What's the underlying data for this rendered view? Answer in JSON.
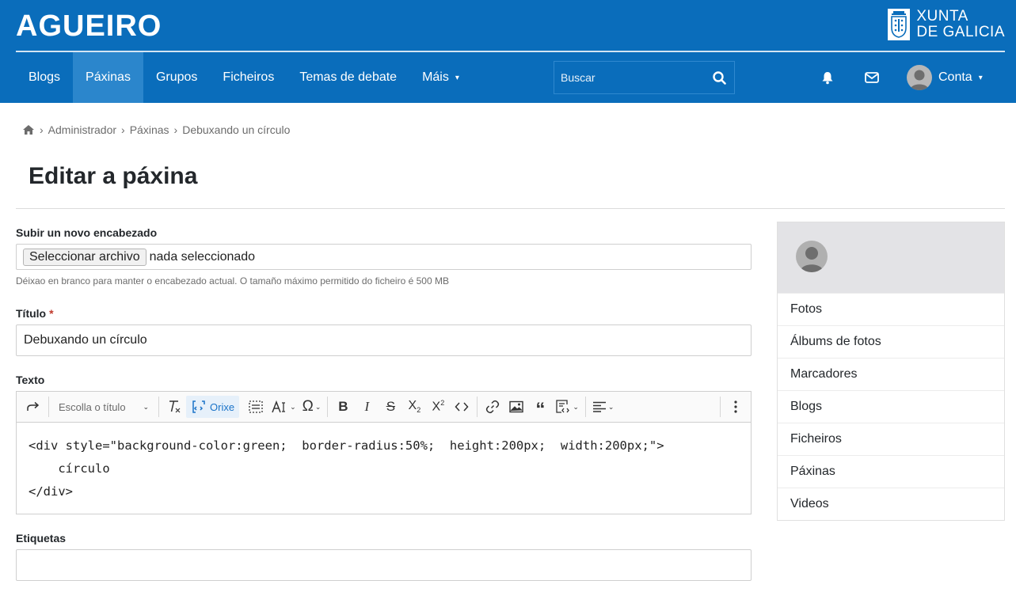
{
  "brand": {
    "name": "AGUEIRO",
    "logo_line1": "XUNTA",
    "logo_line2": "DE GALICIA",
    "seal_icon": "xunta-seal-icon"
  },
  "colors": {
    "header_bg": "#0a6dbb",
    "nav_active_bg": "#2b86cc",
    "accent": "#1a73c8",
    "sidebar_head_bg": "#e3e3e6",
    "required": "#c0392b"
  },
  "nav": {
    "items": [
      {
        "label": "Blogs"
      },
      {
        "label": "Páxinas",
        "active": true
      },
      {
        "label": "Grupos"
      },
      {
        "label": "Ficheiros"
      },
      {
        "label": "Temas de debate"
      },
      {
        "label": "Máis"
      }
    ],
    "more_caret_icon": "chevron-down-icon"
  },
  "search": {
    "placeholder": "Buscar",
    "icon": "search-icon"
  },
  "header_icons": {
    "notifications": "bell-icon",
    "messages": "envelope-icon"
  },
  "account": {
    "label": "Conta",
    "avatar_icon": "user-avatar-icon"
  },
  "breadcrumb": {
    "home_icon": "home-icon",
    "items": [
      "Administrador",
      "Páxinas",
      "Debuxando un círculo"
    ]
  },
  "page": {
    "title": "Editar a páxina"
  },
  "form": {
    "header_upload": {
      "label": "Subir un novo encabezado",
      "button": "Seleccionar archivo",
      "status": "nada seleccionado",
      "help": "Déixao en branco para manter o encabezado actual. O tamaño máximo permitido do ficheiro é 500 MB"
    },
    "title": {
      "label": "Título",
      "required_mark": "*",
      "value": "Debuxando un círculo"
    },
    "text": {
      "label": "Texto",
      "toolbar": {
        "heading_placeholder": "Escolla o título",
        "source_label": "Orixe",
        "icons": [
          "redo-icon",
          "clear-format-icon",
          "source-icon",
          "show-blocks-icon",
          "font-size-icon",
          "special-characters-icon",
          "bold-icon",
          "italic-icon",
          "strikethrough-icon",
          "subscript-icon",
          "superscript-icon",
          "code-icon",
          "link-icon",
          "image-icon",
          "blockquote-icon",
          "html-embed-icon",
          "align-icon",
          "more-options-icon"
        ]
      },
      "content_lines": [
        "<div style=\"background-color:green;  border-radius:50%;  height:200px;  width:200px;\">",
        "    círculo",
        "</div>"
      ]
    },
    "tags": {
      "label": "Etiquetas",
      "value": ""
    }
  },
  "sidebar": {
    "avatar_icon": "user-avatar-icon",
    "items": [
      {
        "label": "Fotos"
      },
      {
        "label": "Álbums de fotos"
      },
      {
        "label": "Marcadores"
      },
      {
        "label": "Blogs"
      },
      {
        "label": "Ficheiros"
      },
      {
        "label": "Páxinas"
      },
      {
        "label": "Videos"
      }
    ]
  }
}
